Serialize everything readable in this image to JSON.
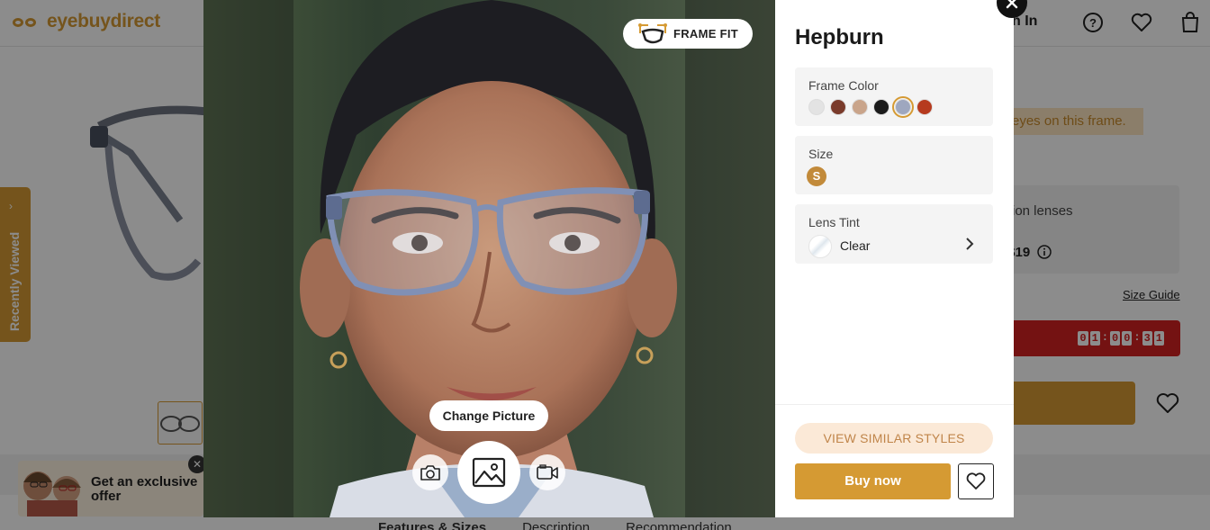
{
  "header": {
    "logo_text": "eyebuydirect",
    "sign_in": "n In"
  },
  "background": {
    "promo_text": "eyes on this frame.",
    "lens_option": "ion lenses",
    "lens_price": ") $19",
    "size_guide": "Size Guide",
    "timer": [
      "0",
      "1",
      "0",
      "0",
      "3",
      "1"
    ],
    "tabs": [
      "Features & Sizes",
      "Description",
      "Recommendation"
    ]
  },
  "recently_viewed": {
    "label": "Recently Viewed"
  },
  "offer": {
    "text_line1": "Get an exclusive",
    "text_line2": "offer"
  },
  "modal": {
    "frame_fit_label": "FRAME FIT",
    "change_picture_label": "Change Picture",
    "product_name": "Hepburn",
    "frame_color": {
      "label": "Frame Color",
      "swatches": [
        "#e3e3e3",
        "#7a3b2b",
        "#c9a48a",
        "#1b1b1b",
        "#9ea7bf",
        "#b63a1e"
      ],
      "selected_index": 4
    },
    "size": {
      "label": "Size",
      "value": "S"
    },
    "lens_tint": {
      "label": "Lens Tint",
      "value": "Clear"
    },
    "view_similar_label": "VIEW SIMILAR STYLES",
    "buy_now_label": "Buy now"
  },
  "colors": {
    "brand": "#d59a33",
    "timer_bg": "#d32222"
  }
}
